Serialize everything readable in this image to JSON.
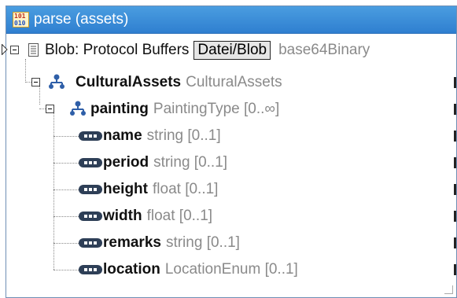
{
  "component": {
    "title": "parse (assets)",
    "title_icon_rows": [
      "101",
      "010"
    ]
  },
  "root": {
    "label": "Blob: Protocol Buffers",
    "button_label": "Datei/Blob",
    "type": "base64Binary"
  },
  "nodes": [
    {
      "label": "CulturalAssets",
      "type": "CulturalAssets",
      "icon": "structure-icon"
    },
    {
      "label": "painting",
      "type": "PaintingType [0..∞]",
      "icon": "structure-icon"
    }
  ],
  "fields": [
    {
      "label": "name",
      "type": "string [0..1]"
    },
    {
      "label": "period",
      "type": "string [0..1]"
    },
    {
      "label": "height",
      "type": "float [0..1]"
    },
    {
      "label": "width",
      "type": "float [0..1]"
    },
    {
      "label": "remarks",
      "type": "string [0..1]"
    },
    {
      "label": "location",
      "type": "LocationEnum [0..1]"
    }
  ]
}
